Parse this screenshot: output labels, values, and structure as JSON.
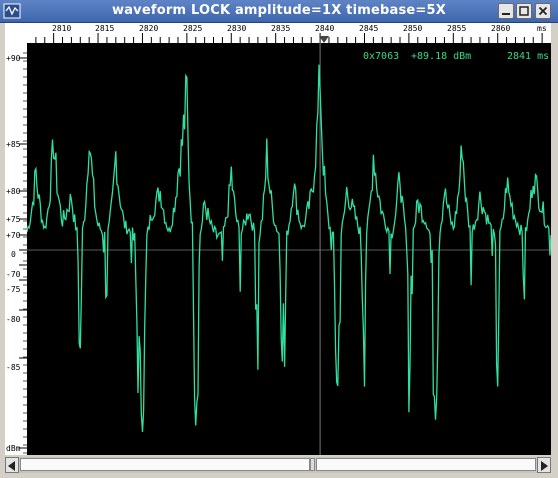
{
  "window": {
    "title": "waveform  LOCK amplitude=1X timebase=5X",
    "controls": [
      {
        "name": "minimize-button",
        "icon": "minimize-icon"
      },
      {
        "name": "maximize-button",
        "icon": "maximize-icon"
      },
      {
        "name": "close-button",
        "icon": "close-icon"
      }
    ]
  },
  "ruler_top": {
    "labels": [
      "2810",
      "2815",
      "2820",
      "2825",
      "2830",
      "2835",
      "2840",
      "2845",
      "2850",
      "2855",
      "2860",
      "ms"
    ],
    "marker_label": "2840"
  },
  "ruler_left": {
    "labels": [
      "+90",
      "+85",
      "+80",
      "+75",
      "+70",
      "0",
      "-70",
      "-75",
      "-80",
      "-85",
      "dBm"
    ]
  },
  "readout": {
    "address": "0x7063",
    "level": "+89.18 dBm",
    "time": "2841 ms"
  },
  "colors": {
    "trace": "#2fe0a0",
    "readout": "#3cd68a",
    "cursor": "#7a7a7a",
    "background": "#000000"
  },
  "chart_data": {
    "type": "line",
    "xlabel": "ms",
    "ylabel": "dBm",
    "xlim": [
      2807,
      2866
    ],
    "cursor_x": 2840,
    "x": [
      2807,
      2808,
      2809,
      2810,
      2811,
      2812,
      2813,
      2814,
      2815,
      2816,
      2817,
      2818,
      2819,
      2820,
      2821,
      2822,
      2823,
      2824,
      2825,
      2826,
      2827,
      2828,
      2829,
      2830,
      2831,
      2832,
      2833,
      2834,
      2835,
      2836,
      2837,
      2838,
      2839,
      2840,
      2841,
      2842,
      2843,
      2844,
      2845,
      2846,
      2847,
      2848,
      2849,
      2850,
      2851,
      2852,
      2853,
      2854,
      2855,
      2856,
      2857,
      2858,
      2859,
      2860,
      2861,
      2862,
      2863,
      2864,
      2865,
      2866
    ],
    "y": [
      71,
      82,
      72,
      85,
      74,
      79,
      66,
      86,
      73,
      69,
      84,
      73,
      70,
      63,
      76,
      80,
      71,
      82,
      88,
      63,
      78,
      71,
      69,
      82,
      70,
      77,
      67,
      84,
      73,
      66,
      81,
      72,
      79,
      89,
      73,
      65,
      80,
      75,
      67,
      84,
      76,
      70,
      82,
      65,
      78,
      74,
      64,
      80,
      72,
      85,
      70,
      79,
      74,
      66,
      81,
      75,
      69,
      82,
      77,
      70
    ]
  }
}
